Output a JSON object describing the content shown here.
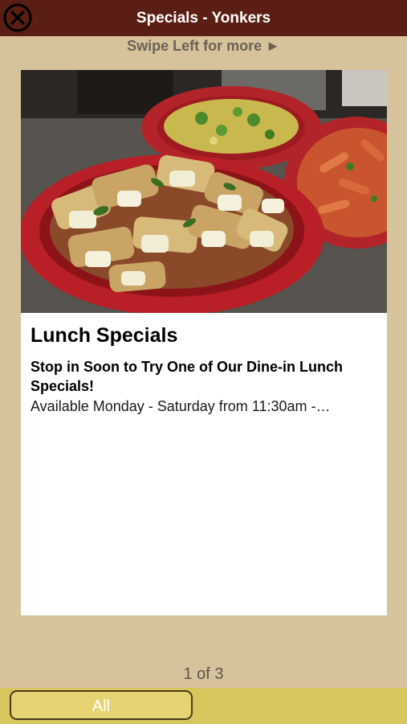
{
  "header": {
    "title": "Specials - Yonkers",
    "close_icon": "close-circle-icon",
    "bar_color": "#5a1e14"
  },
  "swipe_hint": "Swipe Left for more ►",
  "card": {
    "image_alt_icon": "food-photo",
    "title": "Lunch Specials",
    "subtitle": "Stop in Soon to Try One of Our Dine-in Lunch Specials!",
    "body": "Available Monday - Saturday from 11:30am -…"
  },
  "pager": {
    "text": "1 of 3"
  },
  "footer": {
    "all_label": "All",
    "bar_color": "#d9c55e"
  },
  "colors": {
    "background": "#d6c39c"
  }
}
